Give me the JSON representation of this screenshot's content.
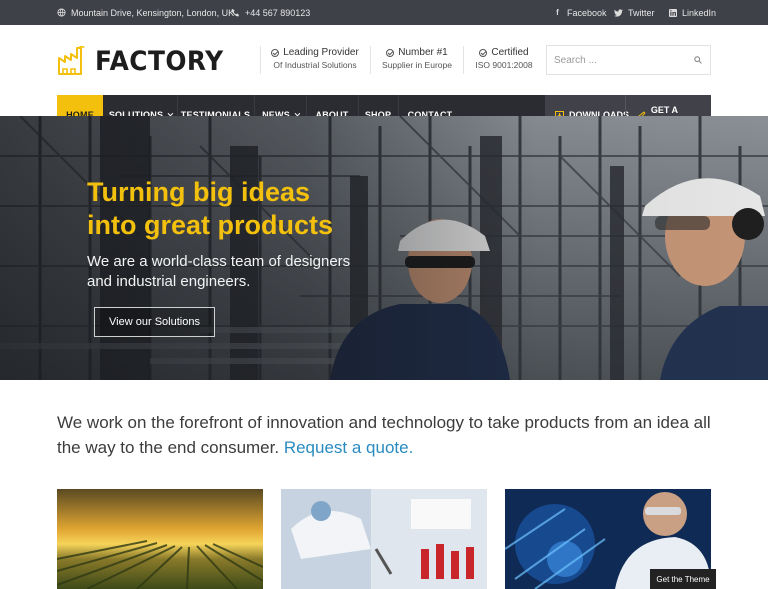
{
  "topbar": {
    "address": "Mountain Drive, Kensington, London, UK",
    "phone": "+44 567 890123",
    "social": [
      "Facebook",
      "Twitter",
      "LinkedIn"
    ]
  },
  "logo": {
    "text": "FACTORY"
  },
  "features": [
    {
      "title": "Leading Provider",
      "subtitle": "Of Industrial Solutions"
    },
    {
      "title": "Number #1",
      "subtitle": "Supplier in Europe"
    },
    {
      "title": "Certified",
      "subtitle": "ISO 9001:2008"
    }
  ],
  "search": {
    "placeholder": "Search ..."
  },
  "nav": {
    "items": [
      "HOME",
      "SOLUTIONS",
      "TESTIMONIALS",
      "NEWS",
      "ABOUT",
      "SHOP",
      "CONTACT"
    ],
    "right": [
      "DOWNLOADS",
      "GET A QUOTE"
    ]
  },
  "hero": {
    "headline_line1": "Turning big ideas",
    "headline_line2": "into great products",
    "sub_line1": "We are a world-class team of designers",
    "sub_line2": "and industrial engineers.",
    "button": "View our Solutions"
  },
  "intro": {
    "text": "We work on the forefront of innovation and technology to take products from an idea all the way to the end consumer.",
    "link": "Request a quote."
  },
  "badge": "Get the Theme",
  "colors": {
    "accent": "#f3c10d",
    "nav_dark": "#2b2c31",
    "topbar": "#3f4149",
    "link": "#2a8bc1"
  }
}
